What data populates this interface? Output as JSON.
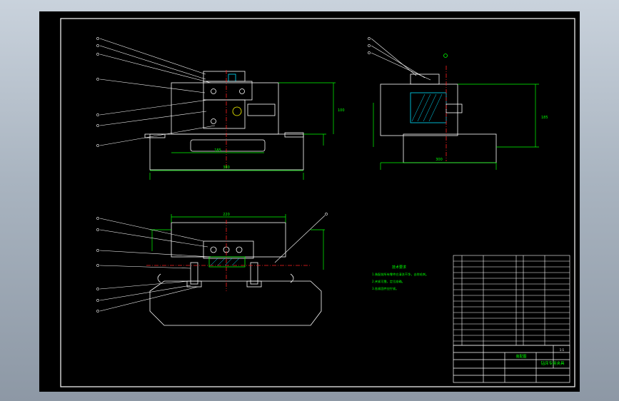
{
  "drawing": {
    "colors": {
      "background": "#000000",
      "outline": "#ffffff",
      "dimension": "#00ff00",
      "centerline": "#ff2020",
      "accent": "#00e0ff",
      "highlight": "#ffff00"
    },
    "tech_notes_title": "技术要求",
    "notes": [
      "1.装配前所有零件应清洗干净，去除毛刺。",
      "2.夹紧可靠，定位准确。",
      "3.各紧固件应拧紧。"
    ],
    "title_block": {
      "drawing_name": "装配图",
      "fixture_name": "钻床专用夹具",
      "scale": "1:1"
    },
    "dimensions": {
      "front_width": "380",
      "front_inner": "185",
      "top_width": "220",
      "side_width": "300",
      "front_height": "100",
      "side_height": "185"
    }
  }
}
